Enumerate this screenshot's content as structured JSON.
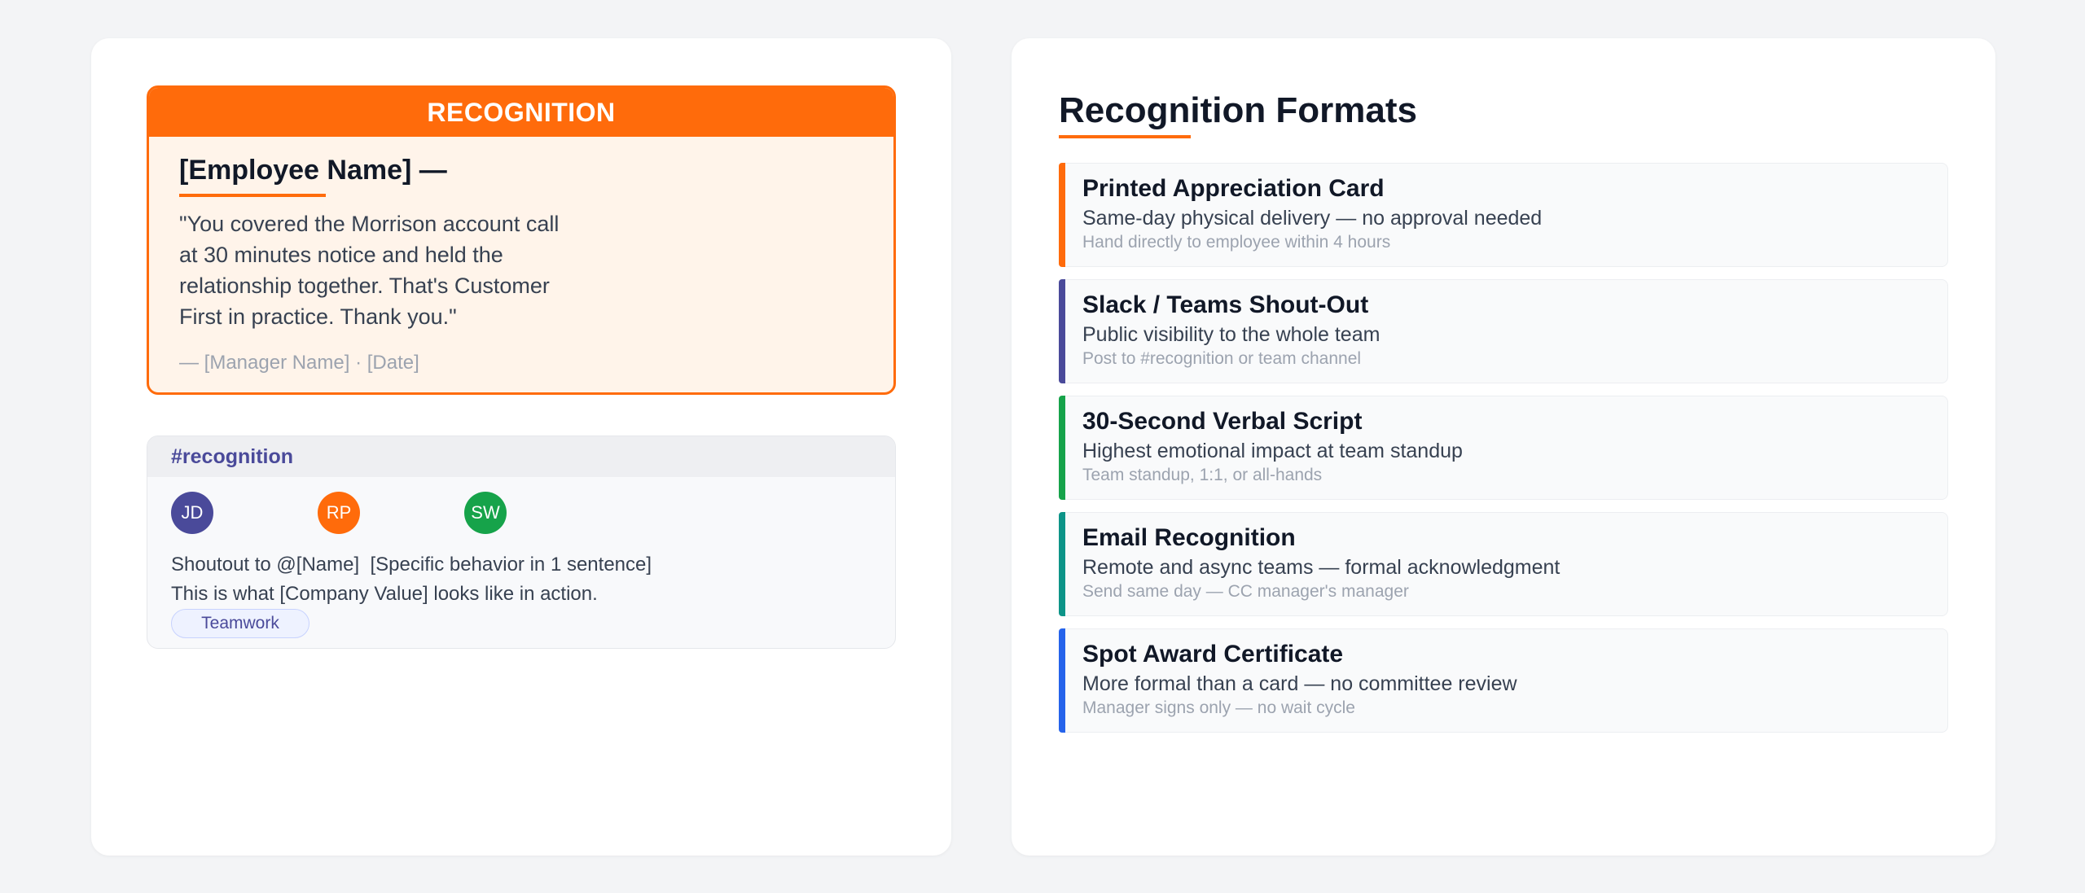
{
  "recognition_card": {
    "header": "RECOGNITION",
    "employee_name": "[Employee Name] —",
    "quote": "\"You covered the Morrison account call\n at 30 minutes notice and held the\n relationship together. That's Customer\n First in practice. Thank you.\"",
    "signoff": "— [Manager Name]  ·  [Date]"
  },
  "slack": {
    "channel": "#recognition",
    "avatars": [
      {
        "initials": "JD",
        "color": "#4a4a9a"
      },
      {
        "initials": "RP",
        "color": "#ff6b0b"
      },
      {
        "initials": "SW",
        "color": "#16a34a"
      }
    ],
    "line1": "Shoutout to @[Name]  [Specific behavior in 1 sentence]",
    "line2": "This is what [Company Value] looks like in action.",
    "tag": "Teamwork"
  },
  "formats": {
    "title": "Recognition Formats",
    "items": [
      {
        "title": "Printed Appreciation Card",
        "subtitle": "Same-day physical delivery — no approval needed",
        "note": "Hand directly to employee within 4 hours",
        "color": "#ff6b0b"
      },
      {
        "title": "Slack / Teams Shout-Out",
        "subtitle": "Public visibility to the whole team",
        "note": "Post to #recognition or team channel",
        "color": "#4a4a9a"
      },
      {
        "title": "30-Second Verbal Script",
        "subtitle": "Highest emotional impact at team standup",
        "note": "Team standup, 1:1, or all-hands",
        "color": "#16a34a"
      },
      {
        "title": "Email Recognition",
        "subtitle": "Remote and async teams — formal acknowledgment",
        "note": "Send same day — CC manager's manager",
        "color": "#0d9488"
      },
      {
        "title": "Spot Award Certificate",
        "subtitle": "More formal than a card — no committee review",
        "note": "Manager signs only — no wait cycle",
        "color": "#2563eb"
      }
    ]
  }
}
